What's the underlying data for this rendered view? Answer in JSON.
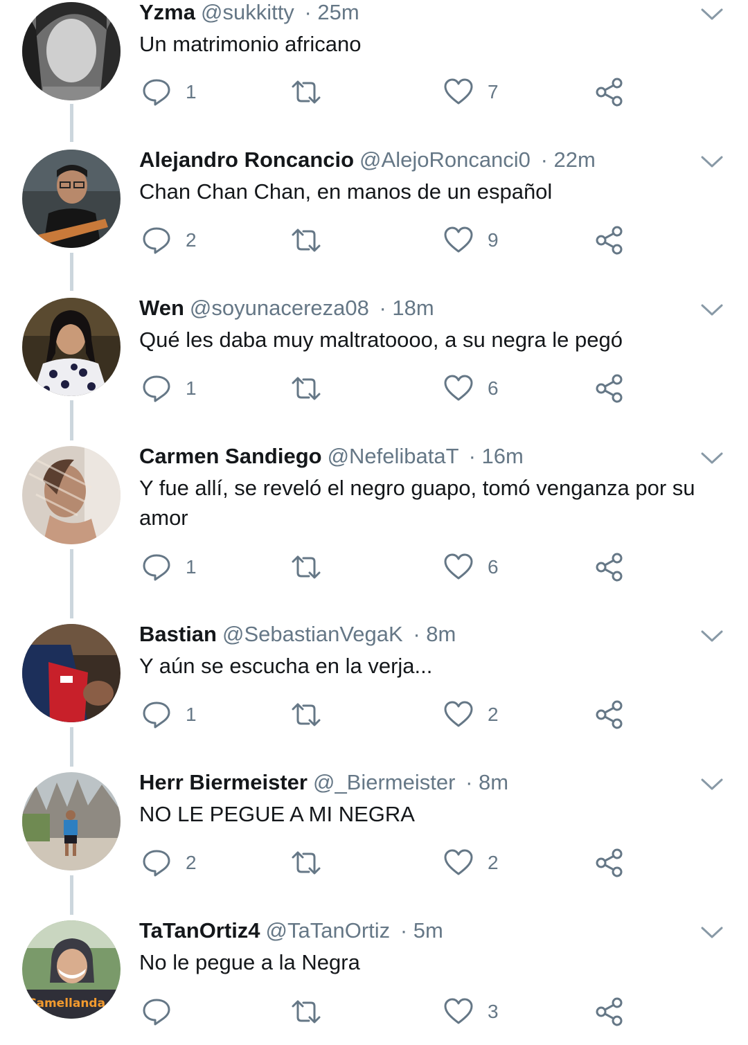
{
  "colors": {
    "text": "#14171a",
    "muted": "#657786",
    "thread_line": "#ccd6dd",
    "background": "#ffffff"
  },
  "icons": {
    "reply": "reply-icon",
    "retweet": "retweet-icon",
    "like": "like-icon",
    "share": "share-icon",
    "menu": "chevron-down-icon"
  },
  "tweets": [
    {
      "name": "Yzma",
      "handle": "@sukkitty",
      "time": "· 25m",
      "text": "Un matrimonio africano",
      "replies": "1",
      "likes": "7"
    },
    {
      "name": "Alejandro Roncancio",
      "handle": "@AlejoRoncanci0",
      "time": "· 22m",
      "text": "Chan Chan Chan, en manos de un español",
      "replies": "2",
      "likes": "9"
    },
    {
      "name": "Wen",
      "handle": "@soyunacereza08",
      "time": "· 18m",
      "text": "Qué les daba muy maltratoooo, a su negra le pegó",
      "replies": "1",
      "likes": "6"
    },
    {
      "name": "Carmen Sandiego",
      "handle": "@NefelibataT",
      "time": "· 16m",
      "text": "Y fue allí, se reveló el negro guapo, tomó venganza por su amor",
      "replies": "1",
      "likes": "6"
    },
    {
      "name": "Bastian",
      "handle": "@SebastianVegaK",
      "time": "· 8m",
      "text": "Y aún se escucha en la verja...",
      "replies": "1",
      "likes": "2"
    },
    {
      "name": "Herr Biermeister",
      "handle": "@_Biermeister",
      "time": "· 8m",
      "text": "NO LE PEGUE A MI NEGRA",
      "replies": "2",
      "likes": "2"
    },
    {
      "name": "TaTanOrtiz4",
      "handle": "@TaTanOrtiz",
      "time": "· 5m",
      "text": "No le pegue a la Negra",
      "replies": "",
      "likes": "3",
      "avatar_text": "Camellanda"
    }
  ]
}
